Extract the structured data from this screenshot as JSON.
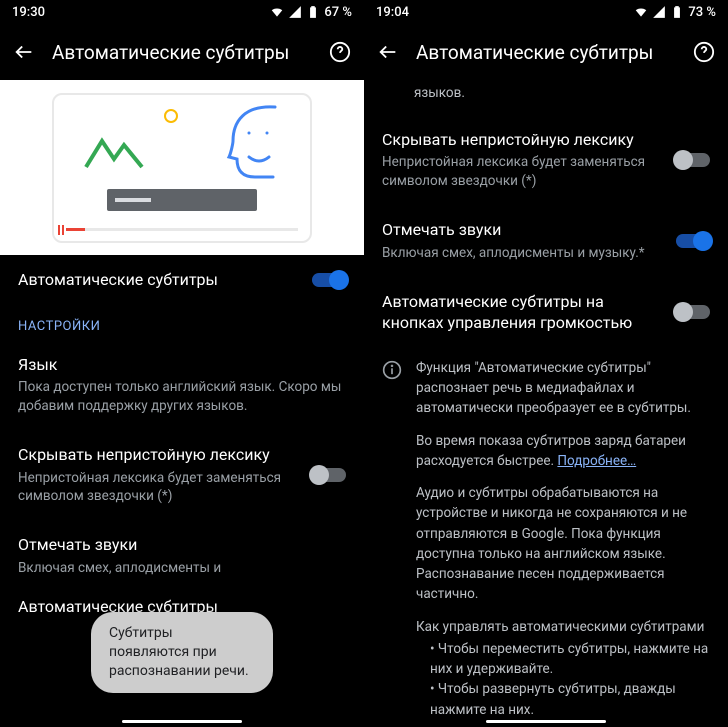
{
  "left": {
    "time": "19:30",
    "battery": "67 %",
    "title": "Автоматические субтитры",
    "main_switch": {
      "label": "Автоматические субтитры",
      "on": true
    },
    "section_label": "НАСТРОЙКИ",
    "language": {
      "title": "Язык",
      "sub": "Пока доступен только английский язык. Скоро мы добавим поддержку других языков."
    },
    "profanity": {
      "title": "Скрывать непристойную лексику",
      "sub": "Непристойная лексика будет заменяться символом звездочки (*)",
      "on": false
    },
    "sounds": {
      "title": "Отмечать звуки",
      "sub_partial": "Включая смех, аплодисменты и"
    },
    "volume_partial": {
      "title": "Автоматические субтитры"
    },
    "toast": "Субтитры появляются при распознавании речи."
  },
  "right": {
    "time": "19:04",
    "battery": "73 %",
    "title": "Автоматические субтитры",
    "lang_tail": "языков.",
    "profanity": {
      "title": "Скрывать непристойную лексику",
      "sub": "Непристойная лексика будет заменяться символом звездочки (*)",
      "on": false
    },
    "sounds": {
      "title": "Отмечать звуки",
      "sub": "Включая смех, аплодисменты и музыку.*",
      "on": true
    },
    "volume": {
      "title": "Автоматические субтитры на кнопках управления громкостью",
      "on": false
    },
    "info": {
      "p1": "Функция \"Автоматические субтитры\" распознает речь в медиафайлах и автоматически преобразует ее в субтитры.",
      "p2a": "Во время показа субтитров заряд батареи расходуется быстрее. ",
      "link": "Подробнее…",
      "p3": "Аудио и субтитры обрабатываются на устройстве и никогда не сохраняются и не отправляются в Google. Пока функция доступна только на английском языке. Распознавание песен поддерживается частично.",
      "p4": "Как управлять автоматическими субтитрами",
      "b1": "Чтобы переместить субтитры, нажмите на них и удерживайте.",
      "b2": "Чтобы развернуть субтитры, дважды нажмите на них."
    }
  }
}
